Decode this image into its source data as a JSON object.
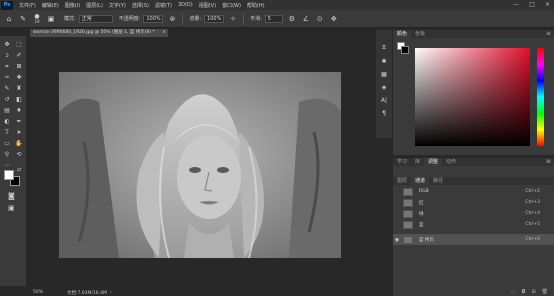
{
  "app": {
    "logo": "Ps"
  },
  "menu": [
    "文件(F)",
    "编辑(E)",
    "图像(I)",
    "图层(L)",
    "文字(Y)",
    "选择(S)",
    "滤镜(T)",
    "3D(D)",
    "视图(V)",
    "窗口(W)",
    "帮助(H)"
  ],
  "window_controls": {
    "minimize": "—",
    "maximize": "□",
    "close": "✕"
  },
  "options": {
    "brush_size": "19",
    "mode_label": "模式:",
    "mode_value": "正常",
    "opacity_label": "不透明度:",
    "opacity_value": "100%",
    "flow_label": "流量:",
    "flow_value": "100%",
    "smooth_label": "平滑:",
    "smooth_value": "5"
  },
  "document": {
    "tab_title": "woman-3990680_1920.jpg @ 50% (图层 1, 蓝 拷贝/8) *",
    "close": "×",
    "zoom": "50%",
    "doc_info": "文档:7.03M/16.4M"
  },
  "color_panel": {
    "tabs": [
      "颜色",
      "色板"
    ],
    "active_tab": 0
  },
  "layers_panel": {
    "tabs": [
      "学习",
      "库",
      "调整",
      "动作"
    ],
    "active_tab": 2,
    "subtabs": [
      "图层",
      "通道",
      "路径"
    ],
    "active_subtab": 1,
    "channels": [
      {
        "name": "RGB",
        "shortcut": "Ctrl+2",
        "visible": false
      },
      {
        "name": "红",
        "shortcut": "Ctrl+3",
        "visible": false
      },
      {
        "name": "绿",
        "shortcut": "Ctrl+4",
        "visible": false
      },
      {
        "name": "蓝",
        "shortcut": "Ctrl+5",
        "visible": false
      },
      {
        "name": "蓝 拷贝",
        "shortcut": "Ctrl+6",
        "visible": true,
        "selected": true
      }
    ]
  }
}
